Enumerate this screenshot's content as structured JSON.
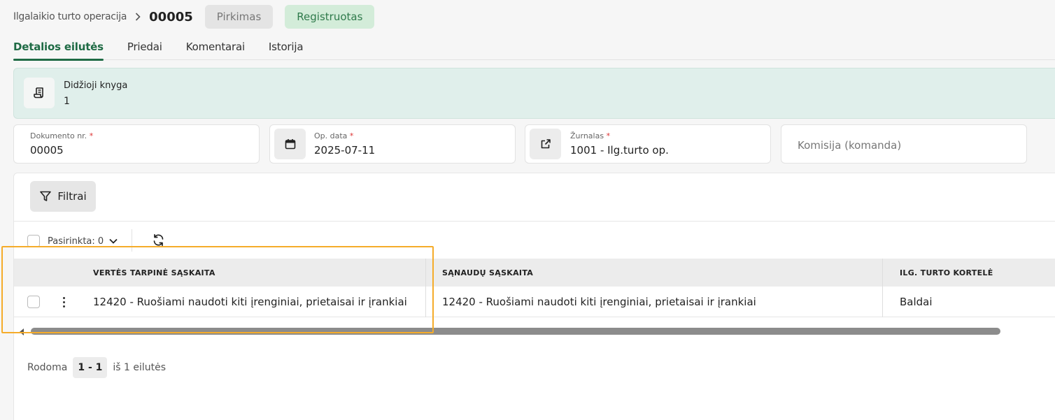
{
  "header": {
    "breadcrumb": "Ilgalaikio turto operacija",
    "doc_number": "00005",
    "type_badge": "Pirkimas",
    "status_badge": "Registruotas",
    "colors": {
      "status_bg": "#d3ecd9",
      "status_text": "#2f7a4b",
      "accent": "#1f6b45"
    }
  },
  "tabs": [
    {
      "label": "Detalios eilutės",
      "active": true
    },
    {
      "label": "Priedai",
      "active": false
    },
    {
      "label": "Komentarai",
      "active": false
    },
    {
      "label": "Istorija",
      "active": false
    }
  ],
  "ledger": {
    "icon": "ledger-scroll-icon",
    "label": "Didžioji knyga",
    "value": "1"
  },
  "fields": {
    "doc_no": {
      "label": "Dokumento nr.",
      "required": "*",
      "value": "00005"
    },
    "op_date": {
      "label": "Op. data",
      "required": "*",
      "value": "2025-07-11",
      "icon": "calendar-icon"
    },
    "journal": {
      "label": "Žurnalas",
      "required": "*",
      "value": "1001 - Ilg.turto op.",
      "icon": "external-link-icon"
    },
    "commission": {
      "placeholder": "Komisija (komanda)"
    }
  },
  "toolbar": {
    "filter_label": "Filtrai",
    "selected_label": "Pasirinkta: 0"
  },
  "table": {
    "columns": [
      "VERTĖS TARPINĖ SĄSKAITA",
      "SĄNAUDŲ SĄSKAITA",
      "ILG. TURTO KORTELĖ"
    ],
    "rows": [
      {
        "cells": [
          "12420 - Ruošiami naudoti kiti įrenginiai, prietaisai ir įrankiai",
          "12420 - Ruošiami naudoti kiti įrenginiai, prietaisai ir įrankiai",
          "Baldai"
        ]
      }
    ]
  },
  "pager": {
    "prefix": "Rodoma",
    "range": "1 - 1",
    "suffix": "iš 1 eilutės"
  }
}
